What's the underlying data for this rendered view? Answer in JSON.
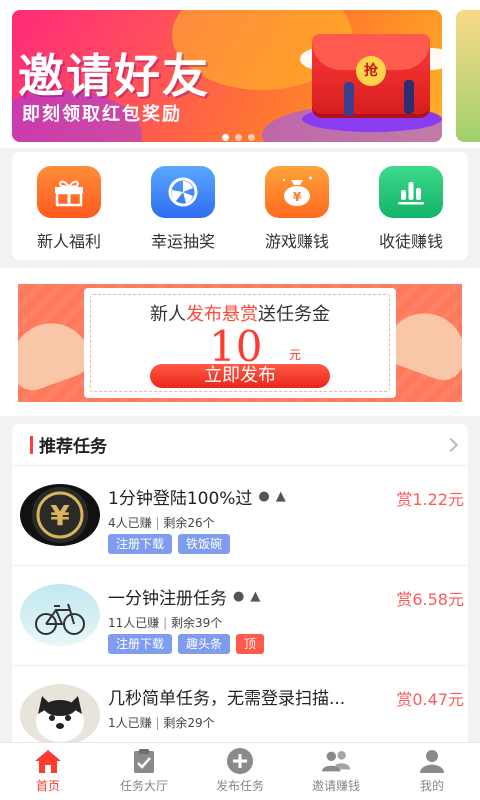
{
  "banner": {
    "title": "邀请好友",
    "subtitle": "即刻领取红包奖励",
    "envelope_text": "抢"
  },
  "quick_menu": [
    {
      "label": "新人福利",
      "icon": "gift-icon",
      "color": "#ff6a26"
    },
    {
      "label": "幸运抽奖",
      "icon": "wheel-icon",
      "color": "#3d7ff5"
    },
    {
      "label": "游戏赚钱",
      "icon": "money-bag-icon",
      "color": "#ff7a24"
    },
    {
      "label": "收徒赚钱",
      "icon": "bar-chart-icon",
      "color": "#1cc174"
    }
  ],
  "promo": {
    "title_prefix": "新人",
    "title_highlight": "发布悬赏",
    "title_suffix": "送任务金",
    "amount": "10",
    "unit": "元",
    "button": "立即发布"
  },
  "recommend": {
    "title": "推荐任务",
    "tasks": [
      {
        "title": "1分钟登陆100%过",
        "reward": "赏1.22元",
        "earned": "4人已赚",
        "remaining": "剩余26个",
        "tags": [
          "注册下载",
          "铁饭碗"
        ],
        "top_tag": "",
        "platforms": [
          "apple-icon",
          "android-icon"
        ],
        "avatar": "coin-avatar"
      },
      {
        "title": "一分钟注册任务",
        "reward": "赏6.58元",
        "earned": "11人已赚",
        "remaining": "剩余39个",
        "tags": [
          "注册下载",
          "趣头条"
        ],
        "top_tag": "顶",
        "platforms": [
          "apple-icon",
          "android-icon"
        ],
        "avatar": "bicycle-avatar"
      },
      {
        "title": "几秒简单任务，无需登录扫描...",
        "reward": "赏0.47元",
        "earned": "1人已赚",
        "remaining": "剩余29个",
        "tags": [],
        "top_tag": "",
        "platforms": [],
        "avatar": "cat-avatar"
      }
    ]
  },
  "tabbar": [
    {
      "label": "首页",
      "icon": "home-icon",
      "active": true
    },
    {
      "label": "任务大厅",
      "icon": "clipboard-icon",
      "active": false
    },
    {
      "label": "发布任务",
      "icon": "plus-circle-icon",
      "active": false
    },
    {
      "label": "邀请赚钱",
      "icon": "users-icon",
      "active": false
    },
    {
      "label": "我的",
      "icon": "profile-icon",
      "active": false
    }
  ]
}
